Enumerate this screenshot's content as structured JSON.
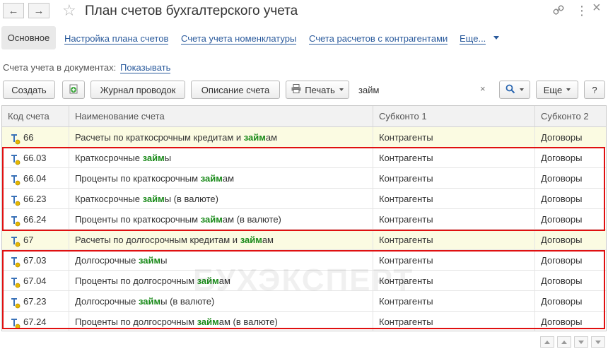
{
  "window": {
    "title": "План счетов бухгалтерского учета",
    "back_icon": "←",
    "forward_icon": "→",
    "star_icon": "☆",
    "link_icon": "🔗",
    "menu_icon": "⋮",
    "close_icon": "×"
  },
  "tabs": [
    {
      "label": "Основное",
      "active": true
    },
    {
      "label": "Настройка плана счетов"
    },
    {
      "label": "Счета учета номенклатуры"
    },
    {
      "label": "Счета расчетов с контрагентами"
    },
    {
      "label": "Еще..."
    }
  ],
  "accounts_in_docs": {
    "label": "Счета учета в документах:",
    "link": "Показывать"
  },
  "toolbar": {
    "create": "Создать",
    "journal": "Журнал проводок",
    "description": "Описание счета",
    "print": "Печать",
    "search_value": "займ",
    "clear": "×",
    "more": "Еще",
    "help": "?"
  },
  "table": {
    "columns": [
      "Код счета",
      "Наименование счета",
      "Субконто 1",
      "Субконто 2"
    ],
    "rows": [
      {
        "code": "66",
        "pre": "Расчеты по краткосрочным кредитам и ",
        "hit": "займ",
        "post": "ам",
        "sub1": "Контрагенты",
        "sub2": "Договоры",
        "highlight": true
      },
      {
        "code": "66.03",
        "pre": "Краткосрочные ",
        "hit": "займ",
        "post": "ы",
        "sub1": "Контрагенты",
        "sub2": "Договоры"
      },
      {
        "code": "66.04",
        "pre": "Проценты по краткосрочным ",
        "hit": "займ",
        "post": "ам",
        "sub1": "Контрагенты",
        "sub2": "Договоры"
      },
      {
        "code": "66.23",
        "pre": "Краткосрочные ",
        "hit": "займ",
        "post": "ы (в валюте)",
        "sub1": "Контрагенты",
        "sub2": "Договоры"
      },
      {
        "code": "66.24",
        "pre": "Проценты по краткосрочным ",
        "hit": "займ",
        "post": "ам (в валюте)",
        "sub1": "Контрагенты",
        "sub2": "Договоры"
      },
      {
        "code": "67",
        "pre": "Расчеты по долгосрочным кредитам и ",
        "hit": "займ",
        "post": "ам",
        "sub1": "Контрагенты",
        "sub2": "Договоры",
        "highlight": true
      },
      {
        "code": "67.03",
        "pre": "Долгосрочные ",
        "hit": "займ",
        "post": "ы",
        "sub1": "Контрагенты",
        "sub2": "Договоры"
      },
      {
        "code": "67.04",
        "pre": "Проценты по долгосрочным ",
        "hit": "займ",
        "post": "ам",
        "sub1": "Контрагенты",
        "sub2": "Договоры"
      },
      {
        "code": "67.23",
        "pre": "Долгосрочные ",
        "hit": "займ",
        "post": "ы (в валюте)",
        "sub1": "Контрагенты",
        "sub2": "Договоры"
      },
      {
        "code": "67.24",
        "pre": "Проценты по долгосрочным ",
        "hit": "займ",
        "post": "ам (в валюте)",
        "sub1": "Контрагенты",
        "sub2": "Договоры"
      }
    ]
  },
  "watermark": "БУХЭКСПЕРТ",
  "colors": {
    "accent_link": "#2a5a9c",
    "search_hit": "#1a8a1a",
    "selection_box": "#e01010",
    "row_highlight": "#fbfbe2"
  }
}
